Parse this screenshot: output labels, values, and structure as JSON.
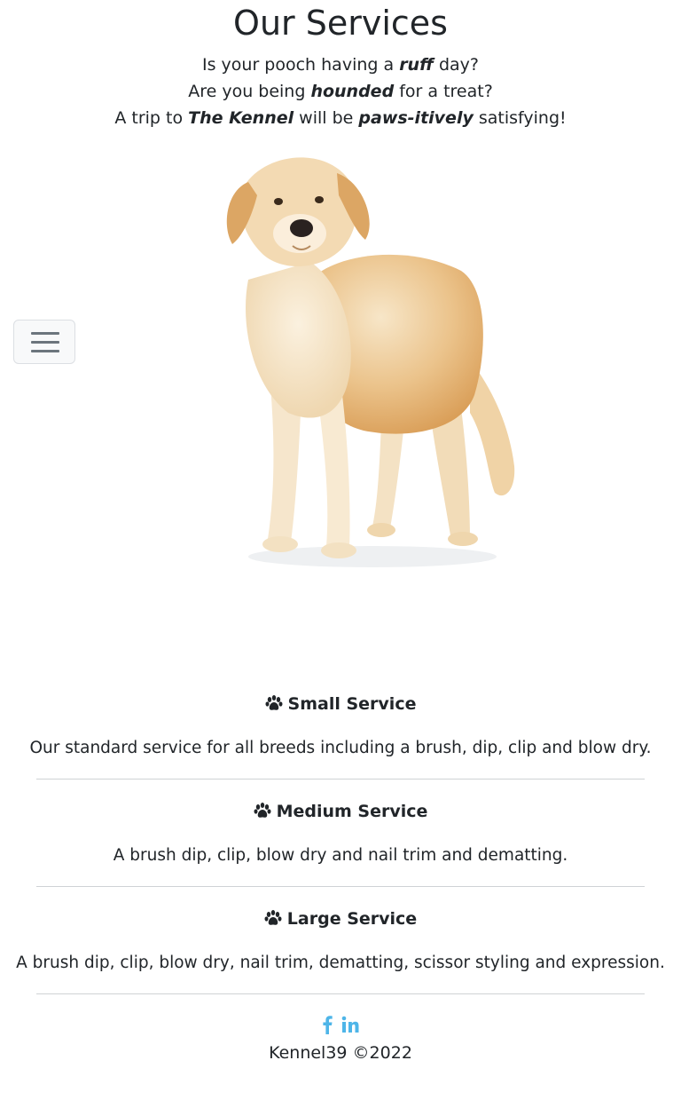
{
  "header": {
    "title": "Our Services",
    "tagline": [
      {
        "pre": "Is your pooch having a ",
        "em": "ruff",
        "post": " day?"
      },
      {
        "pre": "Are you being ",
        "em": "hounded",
        "post": " for a treat?"
      },
      {
        "pre": "A trip to ",
        "em": "The Kennel",
        "mid": " will be ",
        "em2": "paws-itively",
        "post": " satisfying!"
      }
    ]
  },
  "nav": {
    "toggle_icon": "hamburger-icon"
  },
  "hero": {
    "image": "golden-retriever-dog-image"
  },
  "services": [
    {
      "icon": "paw-icon",
      "title": "Small Service",
      "description": "Our standard service for all breeds including a brush, dip, clip and blow dry."
    },
    {
      "icon": "paw-icon",
      "title": "Medium Service",
      "description": "A brush dip, clip, blow dry and nail trim and dematting."
    },
    {
      "icon": "paw-icon",
      "title": "Large Service",
      "description": "A brush dip, clip, blow dry, nail trim, dematting, scissor styling and expression."
    }
  ],
  "footer": {
    "social": [
      {
        "icon": "facebook-icon"
      },
      {
        "icon": "linkedin-icon"
      }
    ],
    "copyright": "Kennel39 ©2022",
    "accent_color": "#4eb5e8"
  }
}
